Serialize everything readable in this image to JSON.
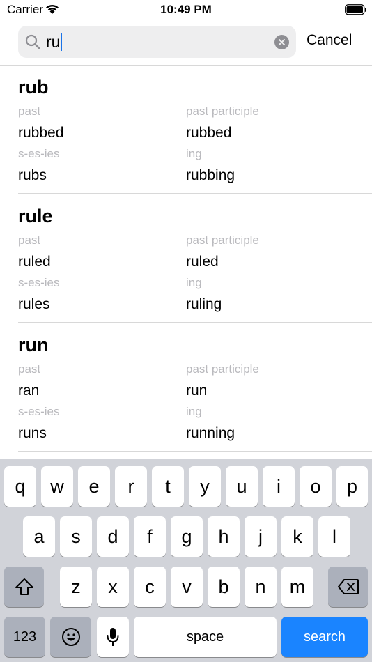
{
  "status": {
    "carrier": "Carrier",
    "time": "10:49 PM"
  },
  "search": {
    "query": "ru",
    "cancel_label": "Cancel"
  },
  "results": [
    {
      "verb": "rub",
      "past_label": "past",
      "past": "rubbed",
      "pp_label": "past participle",
      "pp": "rubbed",
      "ses_label": "s-es-ies",
      "ses": "rubs",
      "ing_label": "ing",
      "ing": "rubbing"
    },
    {
      "verb": "rule",
      "past_label": "past",
      "past": "ruled",
      "pp_label": "past participle",
      "pp": "ruled",
      "ses_label": "s-es-ies",
      "ses": "rules",
      "ing_label": "ing",
      "ing": "ruling"
    },
    {
      "verb": "run",
      "past_label": "past",
      "past": "ran",
      "pp_label": "past participle",
      "pp": "run",
      "ses_label": "s-es-ies",
      "ses": "runs",
      "ing_label": "ing",
      "ing": "running"
    }
  ],
  "keyboard": {
    "row1": [
      "q",
      "w",
      "e",
      "r",
      "t",
      "y",
      "u",
      "i",
      "o",
      "p"
    ],
    "row2": [
      "a",
      "s",
      "d",
      "f",
      "g",
      "h",
      "j",
      "k",
      "l"
    ],
    "row3": [
      "z",
      "x",
      "c",
      "v",
      "b",
      "n",
      "m"
    ],
    "numbers_label": "123",
    "space_label": "space",
    "search_label": "search",
    "icons": {
      "shift": "shift-icon",
      "delete": "delete-icon",
      "emoji": "emoji-icon",
      "mic": "microphone-icon"
    }
  },
  "colors": {
    "accent": "#1a84ff",
    "label_gray": "#b9b9bd",
    "keyboard_bg": "#d1d3d9"
  }
}
